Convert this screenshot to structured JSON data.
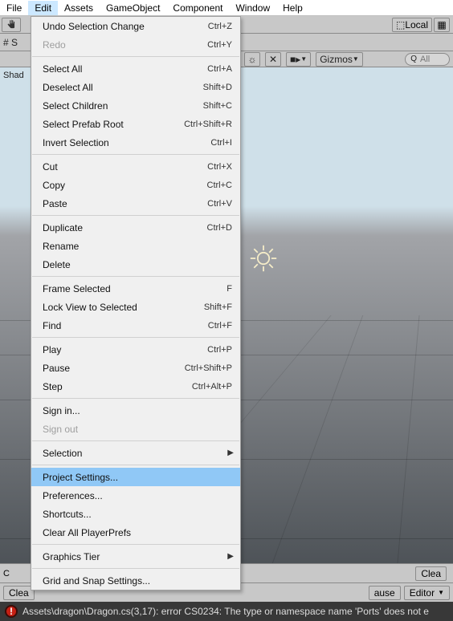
{
  "menubar": {
    "items": [
      "File",
      "Edit",
      "Assets",
      "GameObject",
      "Component",
      "Window",
      "Help"
    ],
    "active_index": 1
  },
  "toolbar": {
    "hand_icon": "hand-icon",
    "local_label": "Local"
  },
  "hierarchy": {
    "scene_prefix": "# S",
    "root_label": "Shad"
  },
  "viewport": {
    "toolbar": {
      "tool1": "⚙",
      "tool2": "✕",
      "camera": "■▸",
      "gizmos_label": "Gizmos",
      "search_prefix": "Q",
      "search_placeholder": "All"
    }
  },
  "dropdown": {
    "groups": [
      [
        {
          "label": "Undo Selection Change",
          "shortcut": "Ctrl+Z",
          "disabled": false
        },
        {
          "label": "Redo",
          "shortcut": "Ctrl+Y",
          "disabled": true
        }
      ],
      [
        {
          "label": "Select All",
          "shortcut": "Ctrl+A"
        },
        {
          "label": "Deselect All",
          "shortcut": "Shift+D"
        },
        {
          "label": "Select Children",
          "shortcut": "Shift+C"
        },
        {
          "label": "Select Prefab Root",
          "shortcut": "Ctrl+Shift+R"
        },
        {
          "label": "Invert Selection",
          "shortcut": "Ctrl+I"
        }
      ],
      [
        {
          "label": "Cut",
          "shortcut": "Ctrl+X"
        },
        {
          "label": "Copy",
          "shortcut": "Ctrl+C"
        },
        {
          "label": "Paste",
          "shortcut": "Ctrl+V"
        }
      ],
      [
        {
          "label": "Duplicate",
          "shortcut": "Ctrl+D"
        },
        {
          "label": "Rename",
          "shortcut": ""
        },
        {
          "label": "Delete",
          "shortcut": ""
        }
      ],
      [
        {
          "label": "Frame Selected",
          "shortcut": "F"
        },
        {
          "label": "Lock View to Selected",
          "shortcut": "Shift+F"
        },
        {
          "label": "Find",
          "shortcut": "Ctrl+F"
        }
      ],
      [
        {
          "label": "Play",
          "shortcut": "Ctrl+P"
        },
        {
          "label": "Pause",
          "shortcut": "Ctrl+Shift+P"
        },
        {
          "label": "Step",
          "shortcut": "Ctrl+Alt+P"
        }
      ],
      [
        {
          "label": "Sign in...",
          "shortcut": ""
        },
        {
          "label": "Sign out",
          "shortcut": "",
          "disabled": true
        }
      ],
      [
        {
          "label": "Selection",
          "shortcut": "",
          "submenu": true
        }
      ],
      [
        {
          "label": "Project Settings...",
          "shortcut": "",
          "highlight": true
        },
        {
          "label": "Preferences...",
          "shortcut": ""
        },
        {
          "label": "Shortcuts...",
          "shortcut": ""
        },
        {
          "label": "Clear All PlayerPrefs",
          "shortcut": ""
        }
      ],
      [
        {
          "label": "Graphics Tier",
          "shortcut": "",
          "submenu": true
        }
      ],
      [
        {
          "label": "Grid and Snap Settings...",
          "shortcut": ""
        }
      ]
    ]
  },
  "console_bar": {
    "clear_label": "C",
    "clea_label": "Clea",
    "pause_label": "ause",
    "editor_label": "Editor"
  },
  "error": {
    "text": "Assets\\dragon\\Dragon.cs(3,17): error CS0234: The type or namespace name 'Ports' does not e"
  }
}
